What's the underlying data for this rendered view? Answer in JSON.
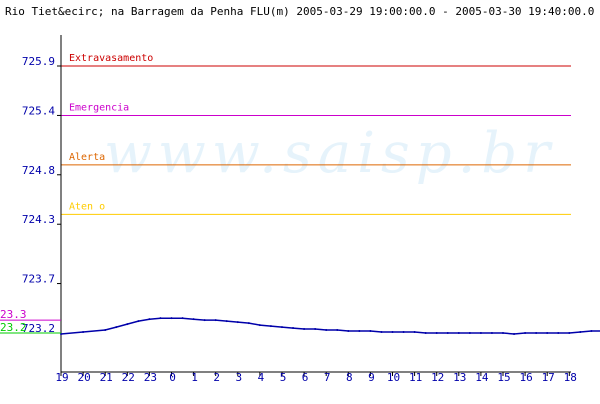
{
  "chart_data": {
    "type": "line",
    "title": "Rio Tiet&ecirc; na Barragem da Penha FLU(m) 2005-03-29 19:00:00.0 - 2005-03-30 19:40:00.0",
    "watermark": "www.saisp.br",
    "xlabel": "",
    "ylabel": "",
    "ylim": [
      723.2,
      725.9
    ],
    "y_ticks": [
      "725.9",
      "725.4",
      "724.8",
      "724.3",
      "723.7",
      "723.2"
    ],
    "x_ticks": [
      "19",
      "20",
      "21",
      "22",
      "23",
      "0",
      "1",
      "2",
      "3",
      "4",
      "5",
      "6",
      "7",
      "8",
      "9",
      "10",
      "11",
      "12",
      "13",
      "14",
      "15",
      "16",
      "17",
      "18"
    ],
    "thresholds": [
      {
        "name": "Extravasamento",
        "value": 725.9,
        "color": "#cc0000"
      },
      {
        "name": "Emergencia",
        "value": 725.4,
        "color": "#cc00cc"
      },
      {
        "name": "Alerta",
        "value": 724.9,
        "color": "#dd6600"
      },
      {
        "name": "Aten  o",
        "value": 724.4,
        "color": "#ffcc00"
      }
    ],
    "side_markers": [
      {
        "label": "23.3",
        "value": 723.33,
        "color": "#cc00cc"
      },
      {
        "label": "23.2",
        "value": 723.2,
        "color": "#00cc00"
      }
    ],
    "series": [
      {
        "color": "#0000aa",
        "x": [
          19,
          20,
          21,
          21.5,
          22,
          22.5,
          23,
          23.5,
          24,
          24.5,
          25,
          25.5,
          26,
          26.5,
          27,
          27.5,
          28,
          28.5,
          29,
          29.5,
          30,
          30.5,
          31,
          31.5,
          32,
          32.5,
          33,
          33.5,
          34,
          34.5,
          35,
          35.5,
          36,
          36.5,
          37,
          37.5,
          38,
          38.5,
          39,
          39.5,
          40,
          40.5,
          41,
          41.5,
          42,
          42.5,
          43,
          43.67
        ],
        "y": [
          723.19,
          723.21,
          723.23,
          723.26,
          723.29,
          723.32,
          723.34,
          723.35,
          723.35,
          723.35,
          723.34,
          723.33,
          723.33,
          723.32,
          723.31,
          723.3,
          723.28,
          723.27,
          723.26,
          723.25,
          723.24,
          723.24,
          723.23,
          723.23,
          723.22,
          723.22,
          723.22,
          723.21,
          723.21,
          723.21,
          723.21,
          723.2,
          723.2,
          723.2,
          723.2,
          723.2,
          723.2,
          723.2,
          723.2,
          723.19,
          723.2,
          723.2,
          723.2,
          723.2,
          723.2,
          723.21,
          723.22,
          723.22
        ]
      }
    ]
  }
}
